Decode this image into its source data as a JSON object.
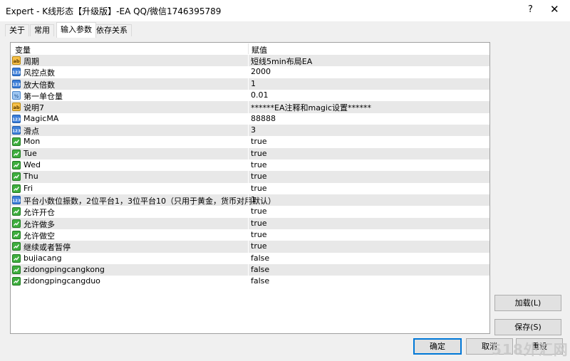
{
  "window": {
    "title": "Expert - K线形态【升级版】-EA  QQ/微信1746395789",
    "help": "?",
    "close": "✕"
  },
  "tabs": [
    {
      "label": "关于"
    },
    {
      "label": "常用"
    },
    {
      "label": "输入参数"
    },
    {
      "label": "依存关系"
    }
  ],
  "table": {
    "col_variable": "变量",
    "col_value": "赋值",
    "rows": [
      {
        "icon": "ab",
        "name": "周期",
        "value": "短线5min布局EA"
      },
      {
        "icon": "123",
        "name": "风控点数",
        "value": "2000"
      },
      {
        "icon": "123",
        "name": "放大倍数",
        "value": "1"
      },
      {
        "icon": "v2",
        "name": "第一单仓量",
        "value": "0.01"
      },
      {
        "icon": "ab",
        "name": "说明7",
        "value": "******EA注释和magic设置******"
      },
      {
        "icon": "123",
        "name": "MagicMA",
        "value": "88888"
      },
      {
        "icon": "123",
        "name": "滑点",
        "value": "3"
      },
      {
        "icon": "bool",
        "name": "Mon",
        "value": "true"
      },
      {
        "icon": "bool",
        "name": "Tue",
        "value": "true"
      },
      {
        "icon": "bool",
        "name": "Wed",
        "value": "true"
      },
      {
        "icon": "bool",
        "name": "Thu",
        "value": "true"
      },
      {
        "icon": "bool",
        "name": "Fri",
        "value": "true"
      },
      {
        "icon": "123",
        "name": "平台小数位振数，2位平台1，3位平台10（只用于黄金，货币对用默认）",
        "value": "1"
      },
      {
        "icon": "bool",
        "name": "允许开仓",
        "value": "true"
      },
      {
        "icon": "bool",
        "name": "允许做多",
        "value": "true"
      },
      {
        "icon": "bool",
        "name": "允许做空",
        "value": "true"
      },
      {
        "icon": "bool",
        "name": "继续或者暂停",
        "value": "true"
      },
      {
        "icon": "bool",
        "name": "bujiacang",
        "value": "false"
      },
      {
        "icon": "bool",
        "name": "zidongpingcangkong",
        "value": "false"
      },
      {
        "icon": "bool",
        "name": "zidongpingcangduo",
        "value": "false"
      }
    ]
  },
  "buttons": {
    "load": "加载(L)",
    "save": "保存(S)",
    "ok": "确定",
    "cancel": "取消",
    "reset": "重设"
  },
  "watermark": "518外汇网",
  "colors": {
    "row_alt": "#e8e8e8",
    "dialog_bg": "#f0f0f0",
    "accent": "#0078d7"
  }
}
